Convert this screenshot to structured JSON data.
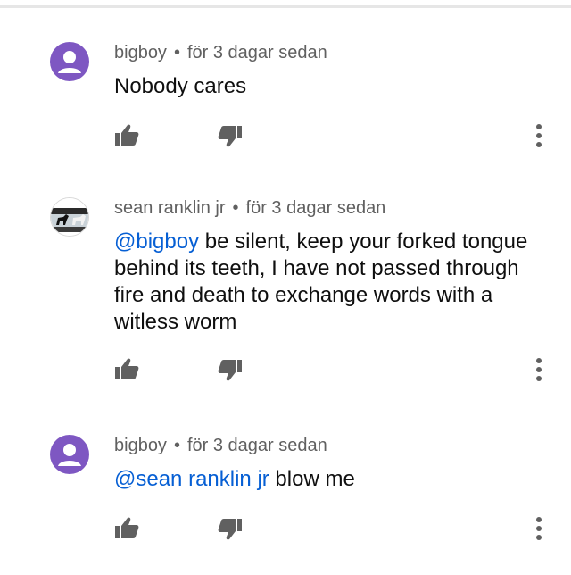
{
  "comments": [
    {
      "author": "bigboy",
      "separator": "•",
      "time": "för 3 dagar sedan",
      "mention": "",
      "text": "Nobody cares",
      "avatar": "purple-default-avatar"
    },
    {
      "author": "sean ranklin jr",
      "separator": "•",
      "time": "för 3 dagar sedan",
      "mention": "@bigboy",
      "text": " be silent, keep your forked tongue behind its teeth, I have not passed through fire and death to exchange words with a witless worm",
      "avatar": "dog-photo-avatar"
    },
    {
      "author": "bigboy",
      "separator": "•",
      "time": "för 3 dagar sedan",
      "mention": "@sean ranklin jr",
      "text": " blow me",
      "avatar": "purple-default-avatar"
    }
  ],
  "icons": {
    "like": "thumbs-up-icon",
    "dislike": "thumbs-down-icon",
    "more": "more-vert-icon"
  },
  "colors": {
    "mention": "#065fd4",
    "meta": "#606060",
    "avatar_purple": "#7e57c2",
    "icon": "#606060"
  }
}
